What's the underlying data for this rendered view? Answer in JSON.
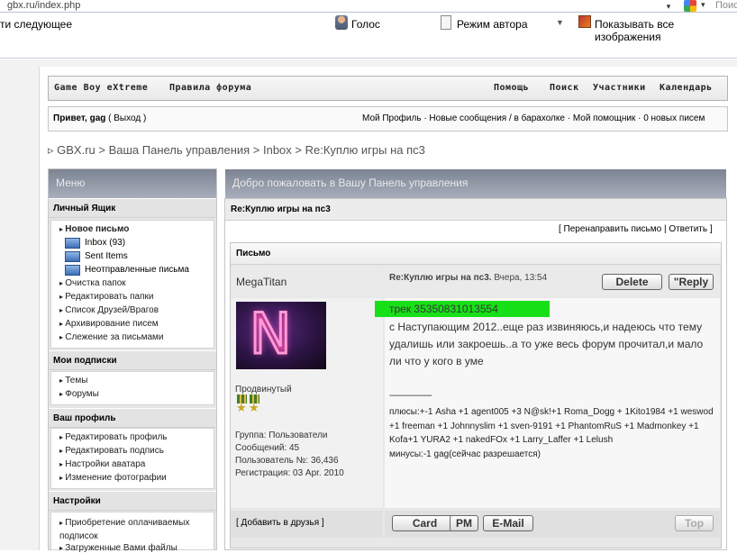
{
  "browser": {
    "url": "gbx.ru/index.php",
    "search_hint": "Поис",
    "toolbar": {
      "next": "ти следующее",
      "voice": "Голос",
      "author_mode": "Режим автора",
      "show_images": "Показывать все изображения"
    }
  },
  "nav": {
    "brand": "Game Boy eXtreme",
    "rules": "Правила форума",
    "help": "Помощь",
    "search": "Поиск",
    "members": "Участники",
    "calendar": "Календарь"
  },
  "userbar": {
    "greeting": "Привет, gag",
    "exit": "( Выход )",
    "right": "Мой Профиль · Новые сообщения / в барахолке · Мой помощник · 0 новых писем"
  },
  "breadcrumb": "▹ GBX.ru > Ваша Панель управления > Inbox > Re:Куплю игры на пс3",
  "menu": {
    "title": "Меню",
    "mailbox": {
      "title": "Личный Ящик",
      "new_message": "Новое письмо",
      "folders": [
        "Inbox (93)",
        "Sent Items",
        "Неотправленные письма"
      ],
      "items": [
        "Очистка папок",
        "Редактировать папки",
        "Список Друзей/Врагов",
        "Архивирование писем",
        "Слежение за письмами"
      ]
    },
    "subscriptions": {
      "title": "Мои подписки",
      "items": [
        "Темы",
        "Форумы"
      ]
    },
    "profile": {
      "title": "Ваш профиль",
      "items": [
        "Редактировать профиль",
        "Редактировать подпись",
        "Настройки аватара",
        "Изменение фотографии"
      ]
    },
    "settings": {
      "title": "Настройки",
      "items": [
        "Приобретение оплачиваемых подписок",
        "Загруженные Вами файлы"
      ]
    }
  },
  "main": {
    "title": "Добро пожаловать в Вашу Панель управления",
    "subject": "Re:Куплю игры на пс3",
    "forward": "[ Перенаправить письмо | Ответить ]",
    "letter_label": "Письмо",
    "author": "MegaTitan",
    "post_title": "Re:Куплю игры на пс3.",
    "post_date": "Вчера, 13:54",
    "delete_btn": "Delete",
    "reply_btn": "Reply",
    "rank": "Продвинутый",
    "group": "Группа: Пользователи",
    "posts": "Сообщений: 45",
    "user_no": "Пользователь №: 36,436",
    "registered": "Регистрация: 03 Apr. 2010",
    "track": "трек 35350831013554",
    "body": "с Наступающим 2012..еще раз извиняюсь,и надеюсь что тему удалишь или закроешь..а то уже весь форум прочитал,и мало ли что у кого в уме",
    "sig_separator": "--------------------",
    "sig_plus": "плюсы:+-1 Asha +1 agent005 +3 N@sk!+1 Roma_Dogg + 1Kito1984 +1 weswod +1 freeman +1 Johnnyslim +1 sven-9191 +1 PhantomRuS +1 Madmonkey +1 Kofa+1 YURA2 +1 nakedFOx +1 Larry_Laffer +1 Lelush",
    "sig_minus": "минусы:-1 gag(сейчас разрешается)",
    "add_friend": "[ Добавить в друзья ]",
    "card_btn": "Card",
    "pm_btn": "PM",
    "email_btn": "E-Mail",
    "top_btn": "Top"
  }
}
